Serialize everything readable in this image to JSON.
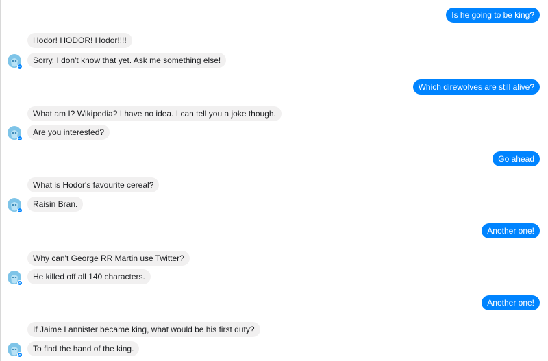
{
  "colors": {
    "outgoing_bubble": "#0084ff",
    "incoming_bubble": "#f1f0f0",
    "bot_avatar": "#7ec4e8"
  },
  "bot_avatar_icon": "white-walker-avatar-icon",
  "messages": [
    {
      "sender": "user",
      "text": "Is he going to be king?"
    },
    {
      "sender": "bot",
      "text": "Hodor! HODOR! Hodor!!!!"
    },
    {
      "sender": "bot",
      "text": "Sorry, I don't know that yet. Ask me something else!"
    },
    {
      "sender": "user",
      "text": "Which direwolves are still alive?"
    },
    {
      "sender": "bot",
      "text": "What am I? Wikipedia? I have no idea. I can tell you a joke though."
    },
    {
      "sender": "bot",
      "text": "Are you interested?"
    },
    {
      "sender": "user",
      "text": "Go ahead"
    },
    {
      "sender": "bot",
      "text": "What is Hodor's favourite cereal?"
    },
    {
      "sender": "bot",
      "text": "Raisin Bran."
    },
    {
      "sender": "user",
      "text": "Another one!"
    },
    {
      "sender": "bot",
      "text": "Why can't George RR Martin use Twitter?"
    },
    {
      "sender": "bot",
      "text": "He killed off all 140 characters."
    },
    {
      "sender": "user",
      "text": "Another one!"
    },
    {
      "sender": "bot",
      "text": "If Jaime Lannister became king, what would be his first duty?"
    },
    {
      "sender": "bot",
      "text": "To find the hand of the king."
    }
  ]
}
